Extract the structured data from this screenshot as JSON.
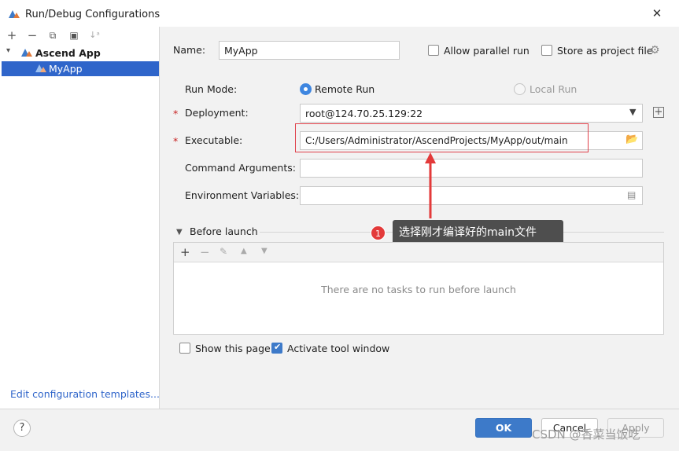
{
  "window": {
    "title": "Run/Debug Configurations"
  },
  "toolbar": {
    "add": "+",
    "remove": "−",
    "copy": "⧉",
    "move": "▣",
    "sort": "↓ᵃ"
  },
  "tree": {
    "group_label": "Ascend App",
    "item_label": "MyApp"
  },
  "form": {
    "name_label": "Name:",
    "name_value": "MyApp",
    "allow_parallel_label": "Allow parallel run",
    "store_project_label": "Store as project file",
    "run_mode_label": "Run Mode:",
    "remote_run_label": "Remote Run",
    "local_run_label": "Local Run",
    "deployment_label": "Deployment:",
    "deployment_value": "root@124.70.25.129:22",
    "executable_label": "Executable:",
    "executable_value": "C:/Users/Administrator/AscendProjects/MyApp/out/main",
    "command_args_label": "Command Arguments:",
    "env_vars_label": "Environment Variables:",
    "required_mark": "*"
  },
  "before_launch": {
    "title": "Before launch",
    "empty_text": "There are no tasks to run before launch"
  },
  "options": {
    "show_page_label": "Show this page",
    "activate_tool_label": "Activate tool window"
  },
  "annotation": {
    "badge_number": "1",
    "text": "选择刚才编译好的main文件"
  },
  "footer": {
    "edit_templates_link": "Edit configuration templates...",
    "help_label": "?",
    "ok_label": "OK",
    "cancel_label": "Cancel",
    "apply_label": "Apply",
    "watermark": "CSDN @香菜当饭吃"
  },
  "colors": {
    "accent": "#3d7ac9",
    "selection": "#2f65ca",
    "annotation_red": "#e33a3a",
    "tooltip_bg": "#4e4e4e"
  }
}
